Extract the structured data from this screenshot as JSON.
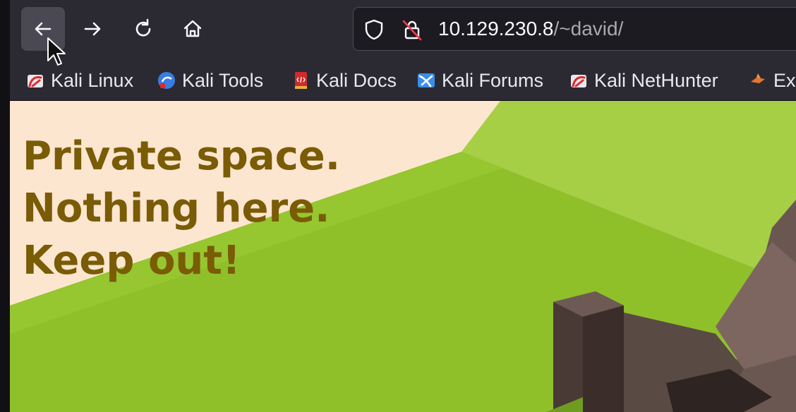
{
  "toolbar": {
    "back_icon": "arrow-left-icon",
    "forward_icon": "arrow-right-icon",
    "reload_icon": "reload-icon",
    "home_icon": "home-icon"
  },
  "urlbar": {
    "shield_icon": "shield-icon",
    "insecure_lock_icon": "lock-insecure-icon",
    "host": "10.129.230.8",
    "path": "/~david/"
  },
  "bookmarks": [
    {
      "label": "Kali Linux",
      "icon": "kali-icon"
    },
    {
      "label": "Kali Tools",
      "icon": "kali-tools-icon"
    },
    {
      "label": "Kali Docs",
      "icon": "kali-docs-icon"
    },
    {
      "label": "Kali Forums",
      "icon": "kali-forums-icon"
    },
    {
      "label": "Kali NetHunter",
      "icon": "kali-icon"
    },
    {
      "label": "Ex",
      "icon": "exploit-db-icon"
    }
  ],
  "page": {
    "headline_lines": [
      "Private space.",
      "Nothing here.",
      "Keep out!"
    ]
  },
  "colors": {
    "headline": "#7a5b06",
    "background_peach": "#fde6cf",
    "grass_green": "#8fc02a",
    "rock_brown": "#5a4a44"
  }
}
